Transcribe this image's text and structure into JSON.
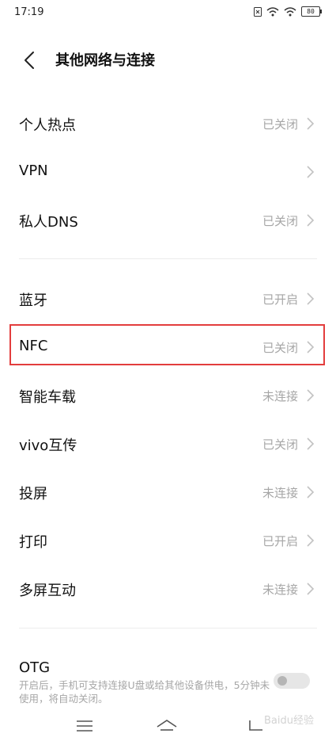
{
  "status_bar": {
    "time": "17:19",
    "battery": "80"
  },
  "header": {
    "title": "其他网络与连接"
  },
  "rows": [
    {
      "label": "个人热点",
      "value": "已关闭"
    },
    {
      "label": "VPN",
      "value": ""
    },
    {
      "label": "私人DNS",
      "value": "已关闭"
    },
    {
      "label": "蓝牙",
      "value": "已开启"
    },
    {
      "label": "NFC",
      "value": "已关闭"
    },
    {
      "label": "智能车载",
      "value": "未连接"
    },
    {
      "label": "vivo互传",
      "value": "已关闭"
    },
    {
      "label": "投屏",
      "value": "未连接"
    },
    {
      "label": "打印",
      "value": "已开启"
    },
    {
      "label": "多屏互动",
      "value": "未连接"
    }
  ],
  "otg": {
    "label": "OTG",
    "description": "开启后，手机可支持连接U盘或给其他设备供电，5分钟未使用，将自动关闭。",
    "enabled": false
  },
  "watermark": "Baidu经验",
  "colors": {
    "highlight": "#e33d3d",
    "secondary_text": "#a6a6a6"
  },
  "icons": [
    "back-arrow-icon",
    "chevron-right-icon",
    "menu-icon",
    "home-icon",
    "back-icon",
    "wifi-icon",
    "signal-icon",
    "battery-icon"
  ]
}
